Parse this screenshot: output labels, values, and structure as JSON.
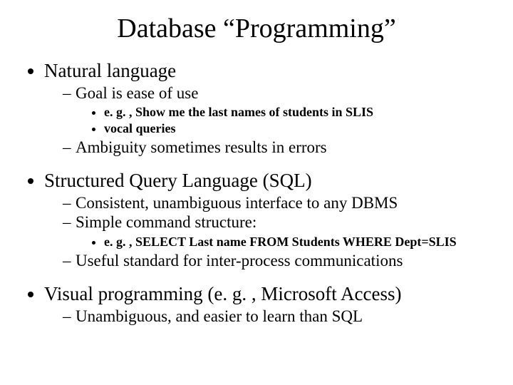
{
  "title": "Database “Programming”",
  "b1": {
    "t": "Natural language",
    "s1": "Goal is ease of use",
    "s1a": "e. g. , Show me the last names of students in SLIS",
    "s1b": "vocal queries",
    "s2": "Ambiguity sometimes results in errors"
  },
  "b2": {
    "t": "Structured Query Language (SQL)",
    "s1": "Consistent, unambiguous interface to any DBMS",
    "s2": "Simple command structure:",
    "s2a": "e. g. , SELECT Last name FROM Students WHERE Dept=SLIS",
    "s3": "Useful standard for inter-process communications"
  },
  "b3": {
    "t": "Visual programming (e. g. , Microsoft Access)",
    "s1": "Unambiguous, and easier to learn than SQL"
  }
}
